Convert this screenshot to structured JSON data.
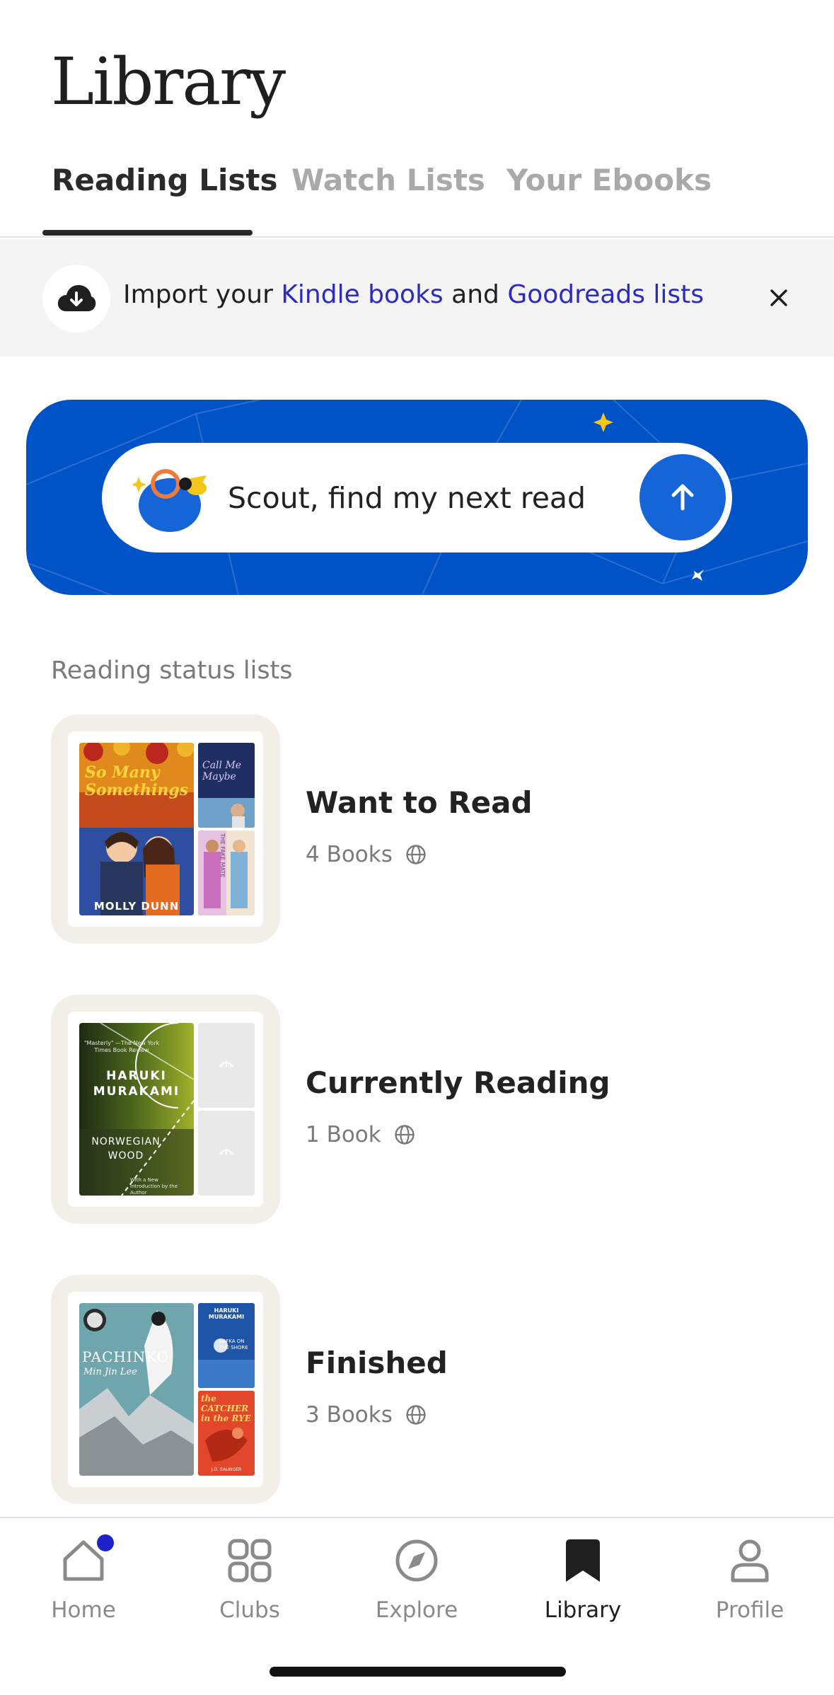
{
  "page_title": "Library",
  "tabs": [
    {
      "label": "Reading Lists",
      "active": true
    },
    {
      "label": "Watch Lists",
      "active": false
    },
    {
      "label": "Your Ebooks",
      "active": false
    }
  ],
  "import_banner": {
    "prefix": "Import your ",
    "link1": "Kindle books",
    "middle": " and ",
    "link2": "Goodreads lists"
  },
  "scout": {
    "prompt": "Scout, find my next read"
  },
  "section_label": "Reading status lists",
  "lists": [
    {
      "name": "Want to Read",
      "count": "4 Books",
      "covers": {
        "main": {
          "title": "So Many Somethings",
          "author": "MOLLY DUNN"
        },
        "top": {
          "title": "Call Me Maybe"
        },
        "bottom": {
          "title": "THE FAKE MATE"
        }
      }
    },
    {
      "name": "Currently Reading",
      "count": "1 Book",
      "covers": {
        "main": {
          "title": "NORWEGIAN WOOD",
          "author": "HARUKI MURAKAMI",
          "blurb": "\"Masterly\" —The New York Times Book Review",
          "note": "With a New Introduction by the Author"
        }
      }
    },
    {
      "name": "Finished",
      "count": "3 Books",
      "covers": {
        "main": {
          "title": "PACHINKO",
          "author": "Min Jin Lee"
        },
        "top": {
          "title": "KAFKA ON THE SHORE",
          "author": "HARUKI MURAKAMI"
        },
        "bottom": {
          "title": "the CATCHER in the RYE",
          "author": "J.D. SALINGER"
        }
      }
    }
  ],
  "nav": [
    {
      "label": "Home",
      "icon": "home-icon",
      "active": false,
      "badge": true
    },
    {
      "label": "Clubs",
      "icon": "grid-icon",
      "active": false
    },
    {
      "label": "Explore",
      "icon": "compass-icon",
      "active": false
    },
    {
      "label": "Library",
      "icon": "bookmark-icon",
      "active": true
    },
    {
      "label": "Profile",
      "icon": "person-icon",
      "active": false
    }
  ],
  "colors": {
    "accent_blue": "#0052c7",
    "link_blue": "#2b2bbf",
    "go_button": "#1565d8",
    "notification_dot": "#1d22c9"
  }
}
